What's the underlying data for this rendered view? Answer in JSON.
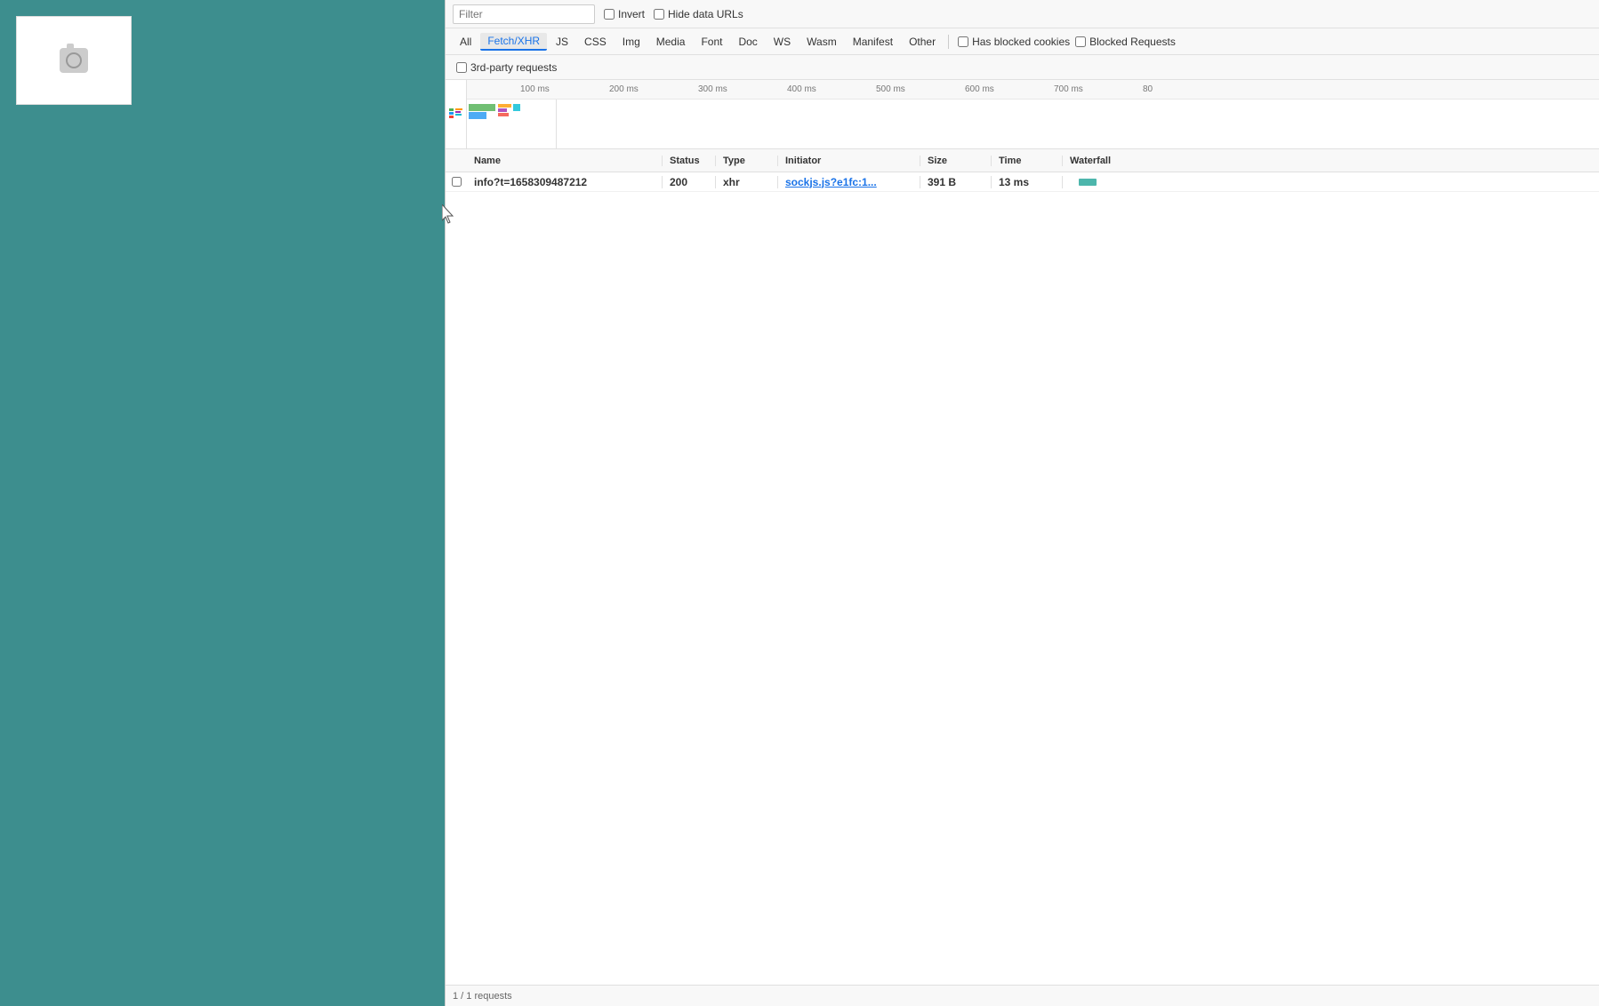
{
  "leftPanel": {
    "backgroundColor": "#3d8e8e"
  },
  "devtools": {
    "toolbar1": {
      "filterPlaceholder": "Filter",
      "invertLabel": "Invert",
      "hideDataUrlsLabel": "Hide data URLs",
      "invertChecked": false,
      "hideDataUrlsChecked": false
    },
    "toolbar2": {
      "tabs": [
        {
          "label": "All",
          "active": false
        },
        {
          "label": "Fetch/XHR",
          "active": true
        },
        {
          "label": "JS",
          "active": false
        },
        {
          "label": "CSS",
          "active": false
        },
        {
          "label": "Img",
          "active": false
        },
        {
          "label": "Media",
          "active": false
        },
        {
          "label": "Font",
          "active": false
        },
        {
          "label": "Doc",
          "active": false
        },
        {
          "label": "WS",
          "active": false
        },
        {
          "label": "Wasm",
          "active": false
        },
        {
          "label": "Manifest",
          "active": false
        },
        {
          "label": "Other",
          "active": false
        }
      ],
      "hasBlockedCookiesLabel": "Has blocked cookies",
      "blockedRequestsLabel": "Blocked Requests"
    },
    "toolbar3": {
      "thirdPartyRequestsLabel": "3rd-party requests",
      "thirdPartyChecked": false
    },
    "timeline": {
      "markers": [
        "100 ms",
        "200 ms",
        "300 ms",
        "400 ms",
        "500 ms",
        "600 ms",
        "700 ms",
        "80"
      ]
    },
    "tableHeaders": {
      "name": "Name",
      "status": "Status",
      "type": "Type",
      "initiator": "Initiator",
      "size": "Size",
      "time": "Time",
      "waterfall": "Waterfall"
    },
    "rows": [
      {
        "name": "info?t=1658309487212",
        "status": "200",
        "type": "xhr",
        "initiator": "sockjs.js?e1fc:1...",
        "size": "391 B",
        "time": "13 ms"
      }
    ]
  }
}
